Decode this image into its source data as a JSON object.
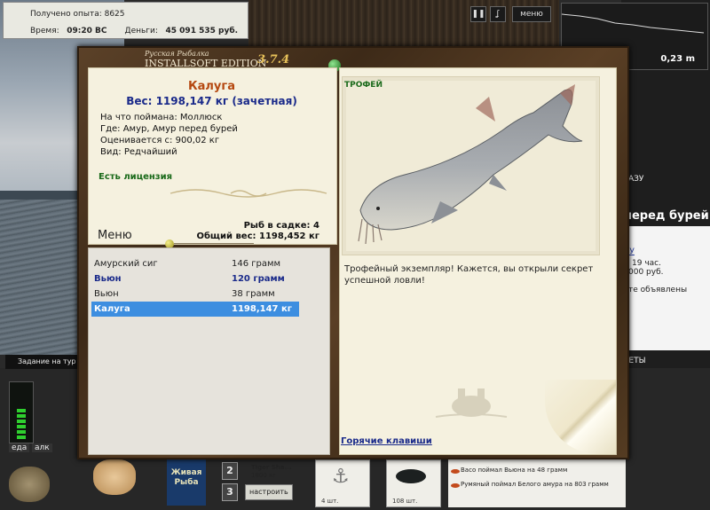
{
  "hud": {
    "experience_label": "Получено опыта: 8625",
    "time_label": "Время:",
    "time_value": "09:20 ВС",
    "money_label": "Деньги:",
    "money_value": "45 091 535 руб.",
    "pause_icon": "pause-icon",
    "hook_icon": "hook-icon",
    "menu_label": "меню",
    "depth_value": "0,23 m"
  },
  "dialog": {
    "brand_small": "Русская Рыбалка",
    "brand_large": "INSTALLSOFT EDITION",
    "version": "3.7.4",
    "fish": {
      "name": "Калуга",
      "weight": "Вес: 1198,147 кг (зачетная)",
      "details": [
        "На что поймана: Моллюск",
        "Где: Амур, Амур перед бурей",
        "Оценивается с: 900,02 кг",
        "Вид: Редчайший"
      ],
      "license": "Есть лицензия"
    },
    "keepnet": {
      "count": "Рыб в садке: 4",
      "total_weight": "Общий вес: 1198,452 кг"
    },
    "menu_label": "Меню",
    "catch_list": [
      {
        "name": "Амурский сиг",
        "weight": "146 грамм",
        "style": "normal"
      },
      {
        "name": "Вьюн",
        "weight": "120 грамм",
        "style": "bold"
      },
      {
        "name": "Вьюн",
        "weight": "38 грамм",
        "style": "normal"
      },
      {
        "name": "Калуга",
        "weight": "1198,147 кг",
        "style": "selected"
      }
    ],
    "trophy_label": "ТРОФЕЙ",
    "description": "Трофейный экземпляр! Кажется, вы открыли секрет успешной ловли!",
    "hotkeys": "Горячие клавиши"
  },
  "right_pane": {
    "location_title": "перед бурей",
    "line1": "19 час.",
    "line2": "000 руб.",
    "line3": "те объявлены",
    "line4": "РЕТЫ",
    "ku": "КУ",
    "az": "АЗУ"
  },
  "bottom": {
    "task_label": "Задание на тур",
    "eat_label": "еда",
    "alc_label": "алк",
    "live_bait": "Живая Рыба",
    "bait_name": "Tiger Sha...",
    "bait_weight": "1800 кг",
    "setup_button": "настроить",
    "slot_btn_2": "2",
    "slot_btn_3": "3",
    "slot_counts": [
      "4 шт.",
      "108 шт."
    ],
    "feed": [
      "Васо поймал Вьюна на 48 грамм",
      "Румяный поймал Белого амура на 803 грамм"
    ]
  },
  "colors": {
    "fish_name": "#b54810",
    "weight_text": "#1a2a8a",
    "license_text": "#1a6a1a",
    "selection": "#3d8ee0",
    "wood_frame": "#4a3420",
    "paper": "#f5f1df"
  }
}
